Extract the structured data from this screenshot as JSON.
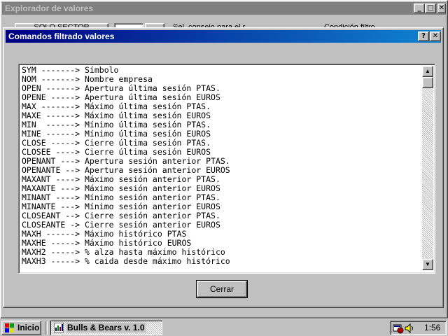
{
  "main_window": {
    "title": "Explorador de valores",
    "controls": {
      "minimize": "_",
      "maximize": "□",
      "close": "✕"
    },
    "solo_sector_label": "SOLO SECTOR",
    "hint_left": "Sel. consejo para el r.",
    "hint_right": "Condición filtro"
  },
  "dialog": {
    "title": "Comandos filtrado valores",
    "help_glyph": "?",
    "close_glyph": "✕",
    "lines": [
      "SYM -------> Símbolo",
      "NOM -------> Nombre empresa",
      "OPEN ------> Apertura última sesión PTAS.",
      "OPENE -----> Apertura última sesión EUROS",
      "MAX -------> Máximo última sesión PTAS.",
      "MAXE ------> Máximo última sesión EUROS",
      "MIN  ------> Mínimo última sesión PTAS.",
      "MINE ------> Mínimo última sesión EUROS",
      "CLOSE -----> Cierre última sesión PTAS.",
      "CLOSEE ----> Cierre última sesión EUROS",
      "OPENANT ---> Apertura sesión anterior PTAS.",
      "OPENANTE --> Apertura sesión anterior EUROS",
      "MAXANT ----> Máximo sesión anterior PTAS.",
      "MAXANTE ---> Máximo sesión anterior EUROS",
      "MINANT ----> Mínimo sesión anterior PTAS.",
      "MINANTE ---> Mínimo sesión anterior EUROS",
      "CLOSEANT --> Cierre sesión anterior PTAS.",
      "CLOSEANTE -> Cierre sesión anterior EUROS",
      "MAXH ------> Máximo histórico PTAS",
      "MAXHE -----> Máximo histórico EUROS",
      "MAXH2 -----> % alza hasta máximo histórico",
      "MAXH3 -----> % caida desde máximo histórico"
    ],
    "scroll_up_glyph": "▲",
    "scroll_down_glyph": "▼",
    "close_button_label": "Cerrar"
  },
  "taskbar": {
    "start_label": "Inicio",
    "task_label": "Bulls & Bears v. 1.0",
    "clock": "1:56"
  },
  "colors": {
    "desktop": "#008080",
    "active_title": "#000080",
    "inactive_title": "#808080",
    "face": "#c0c0c0"
  }
}
